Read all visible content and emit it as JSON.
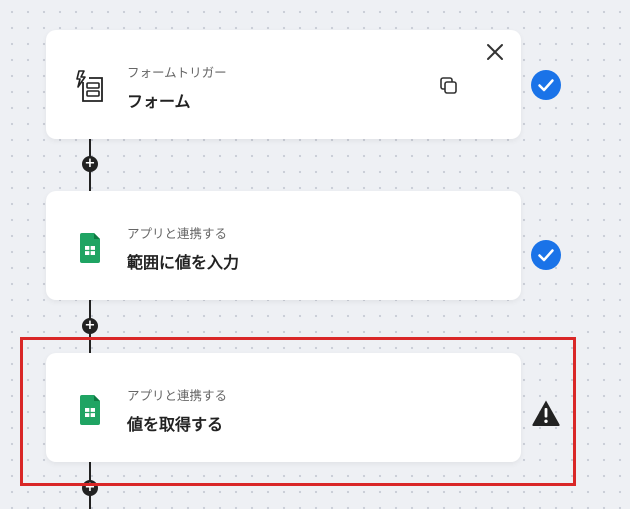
{
  "cards": [
    {
      "subtitle": "フォームトリガー",
      "title": "フォーム",
      "status": "complete"
    },
    {
      "subtitle": "アプリと連携する",
      "title": "範囲に値を入力",
      "status": "complete"
    },
    {
      "subtitle": "アプリと連携する",
      "title": "値を取得する",
      "status": "warning"
    }
  ],
  "colors": {
    "check": "#1a73e8",
    "highlight": "#d92727",
    "sheets_green": "#1fa463"
  }
}
